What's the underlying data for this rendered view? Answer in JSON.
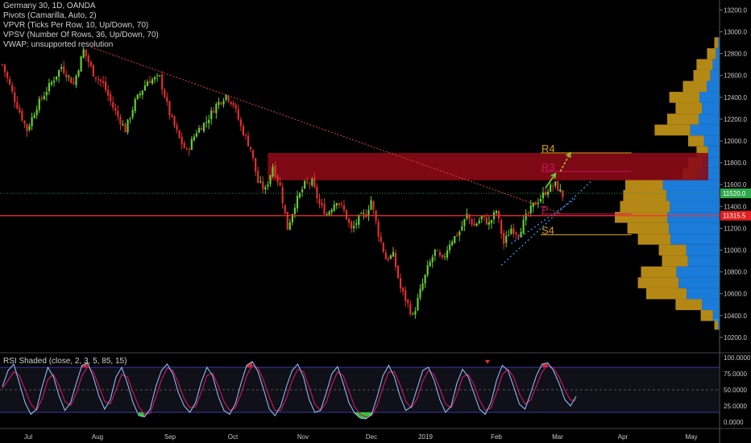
{
  "legend": {
    "symbol": "Germany 30, 1D, OANDA",
    "pivots": "Pivots (Camarilla, Auto, 2)",
    "vpvr": "VPVR (Ticks Per Row, 10, Up/Down, 70)",
    "vpsv": "VPSV (Number Of Rows, 36, Up/Down, 70)",
    "vwap": "VWAP: unsupported resolution"
  },
  "rsi_title": "RSI Shaded (close, 2, 3, 5, 85, 15)",
  "colors": {
    "background": "#000000",
    "up": "#66cc33",
    "down": "#e03030",
    "resistance_zone": "#8b0a16",
    "volume_up": "#d4a017",
    "volume_down": "#1e90ff",
    "pivot_r4": "#d4a017",
    "pivot_r3": "#c2185b",
    "pivot_p": "#c2185b",
    "pivot_s4": "#d4a017",
    "support_line": "#ff2a2a",
    "trendline": "#e04040",
    "channel": "#3aa0ff"
  },
  "pivot_labels": {
    "r4": "R4",
    "r3": "R3",
    "p": "P",
    "s4": "S4"
  },
  "price_badges": {
    "current": "11520.0",
    "support": "11315.5"
  },
  "chart_data": [
    {
      "type": "candlestick",
      "title": "Germany 30, 1D, OANDA",
      "x_ticks": [
        "Jul",
        "Aug",
        "Sep",
        "Oct",
        "Nov",
        "Dec",
        "2019",
        "Feb",
        "Mar",
        "Apr",
        "May"
      ],
      "y_ticks": [
        "10200.0",
        "10400.0",
        "10600.0",
        "10800.0",
        "11000.0",
        "11200.0",
        "11400.0",
        "11600.0",
        "11800.0",
        "12000.0",
        "12200.0",
        "12400.0",
        "12600.0",
        "12800.0",
        "13000.0",
        "13200.0"
      ],
      "ylim": [
        10140,
        13240
      ],
      "close_path": [
        [
          0,
          12700
        ],
        [
          5,
          12380
        ],
        [
          10,
          12100
        ],
        [
          14,
          12320
        ],
        [
          19,
          12500
        ],
        [
          24,
          12680
        ],
        [
          29,
          12520
        ],
        [
          33,
          12830
        ],
        [
          37,
          12620
        ],
        [
          41,
          12520
        ],
        [
          45,
          12310
        ],
        [
          50,
          12100
        ],
        [
          54,
          12360
        ],
        [
          59,
          12550
        ],
        [
          64,
          12580
        ],
        [
          68,
          12250
        ],
        [
          72,
          12020
        ],
        [
          75,
          11900
        ],
        [
          79,
          12090
        ],
        [
          83,
          12180
        ],
        [
          87,
          12330
        ],
        [
          91,
          12420
        ],
        [
          94,
          12340
        ],
        [
          97,
          12130
        ],
        [
          101,
          11930
        ],
        [
          104,
          11620
        ],
        [
          107,
          11550
        ],
        [
          110,
          11770
        ],
        [
          113,
          11580
        ],
        [
          116,
          11200
        ],
        [
          119,
          11420
        ],
        [
          123,
          11600
        ],
        [
          126,
          11620
        ],
        [
          129,
          11420
        ],
        [
          132,
          11330
        ],
        [
          136,
          11460
        ],
        [
          139,
          11360
        ],
        [
          142,
          11180
        ],
        [
          145,
          11290
        ],
        [
          148,
          11330
        ],
        [
          150,
          11460
        ],
        [
          153,
          11150
        ],
        [
          156,
          10920
        ],
        [
          159,
          10950
        ],
        [
          162,
          10650
        ],
        [
          165,
          10500
        ],
        [
          167,
          10390
        ],
        [
          170,
          10620
        ],
        [
          173,
          10830
        ],
        [
          176,
          10990
        ],
        [
          179,
          10900
        ],
        [
          182,
          11070
        ],
        [
          186,
          11170
        ],
        [
          189,
          11320
        ],
        [
          192,
          11220
        ],
        [
          195,
          11300
        ],
        [
          198,
          11240
        ],
        [
          201,
          11360
        ],
        [
          204,
          11060
        ],
        [
          207,
          11200
        ],
        [
          210,
          11150
        ],
        [
          213,
          11300
        ],
        [
          216,
          11410
        ],
        [
          219,
          11480
        ],
        [
          222,
          11560
        ],
        [
          225,
          11600
        ],
        [
          228,
          11500
        ]
      ],
      "series_annotations": {
        "current_price": 11520.0,
        "support_level": 11315.5,
        "resistance_zone": [
          11640,
          11890
        ],
        "pivots": {
          "R4": 11890,
          "R3": 11720,
          "P": 11330,
          "S4": 11140
        },
        "projection_arrows": [
          [
            221,
            11570,
            225,
            11700
          ],
          [
            227,
            11720,
            231,
            11890
          ]
        ]
      }
    },
    {
      "type": "area",
      "title": "VPVR (Ticks Per Row, 10, Up/Down, 70)",
      "profile_price": [
        10320,
        10400,
        10500,
        10600,
        10700,
        10800,
        10900,
        11000,
        11100,
        11200,
        11300,
        11400,
        11500,
        11600,
        11700,
        11800,
        11900,
        12000,
        12100,
        12200,
        12300,
        12400,
        12500,
        12600,
        12700,
        12800,
        12900
      ],
      "profile_total": [
        0.05,
        0.18,
        0.42,
        0.7,
        0.78,
        0.75,
        0.55,
        0.58,
        0.78,
        0.88,
        1.0,
        0.95,
        0.92,
        0.9,
        0.35,
        0.3,
        0.22,
        0.3,
        0.62,
        0.5,
        0.42,
        0.48,
        0.35,
        0.25,
        0.22,
        0.12,
        0.05
      ],
      "profile_down_share": [
        0.3,
        0.35,
        0.4,
        0.45,
        0.5,
        0.55,
        0.55,
        0.55,
        0.6,
        0.55,
        0.5,
        0.5,
        0.55,
        0.6,
        0.6,
        0.55,
        0.5,
        0.5,
        0.45,
        0.4,
        0.4,
        0.4,
        0.35,
        0.35,
        0.3,
        0.3,
        0.3
      ]
    },
    {
      "type": "line",
      "title": "RSI Shaded (close, 2, 3, 5, 85, 15)",
      "ylim": [
        0,
        100
      ],
      "y_ticks": [
        "100.0000",
        "75.0000",
        "50.0000",
        "25.0000",
        "0.0000"
      ],
      "levels": [
        85,
        50,
        15
      ],
      "rsi": [
        55,
        80,
        90,
        60,
        30,
        12,
        20,
        55,
        85,
        70,
        40,
        18,
        30,
        60,
        88,
        92,
        70,
        40,
        20,
        35,
        70,
        85,
        60,
        30,
        10,
        8,
        20,
        55,
        80,
        90,
        75,
        45,
        25,
        15,
        30,
        62,
        85,
        72,
        40,
        18,
        12,
        28,
        60,
        88,
        94,
        78,
        50,
        20,
        10,
        25,
        55,
        80,
        90,
        70,
        35,
        15,
        18,
        45,
        75,
        86,
        60,
        30,
        14,
        6,
        5,
        12,
        40,
        72,
        88,
        70,
        40,
        18,
        24,
        52,
        80,
        85,
        65,
        35,
        15,
        25,
        60,
        82,
        70,
        45,
        20,
        12,
        30,
        65,
        88,
        80,
        55,
        28,
        20,
        45,
        72,
        90,
        92,
        80,
        60,
        35,
        25,
        40
      ],
      "signal": [
        52,
        65,
        78,
        72,
        50,
        28,
        18,
        36,
        66,
        74,
        56,
        32,
        26,
        44,
        72,
        86,
        78,
        55,
        32,
        28,
        50,
        74,
        70,
        46,
        24,
        12,
        14,
        38,
        66,
        84,
        80,
        60,
        36,
        22,
        24,
        46,
        72,
        76,
        56,
        32,
        18,
        22,
        44,
        72,
        88,
        84,
        64,
        38,
        18,
        18,
        38,
        64,
        82,
        78,
        54,
        28,
        18,
        30,
        58,
        78,
        72,
        48,
        24,
        12,
        8,
        10,
        26,
        54,
        78,
        78,
        58,
        32,
        22,
        36,
        64,
        80,
        74,
        52,
        28,
        22,
        42,
        70,
        74,
        58,
        34,
        18,
        22,
        46,
        74,
        82,
        70,
        44,
        28,
        34,
        56,
        78,
        88,
        84,
        70,
        50,
        34,
        34
      ]
    }
  ]
}
